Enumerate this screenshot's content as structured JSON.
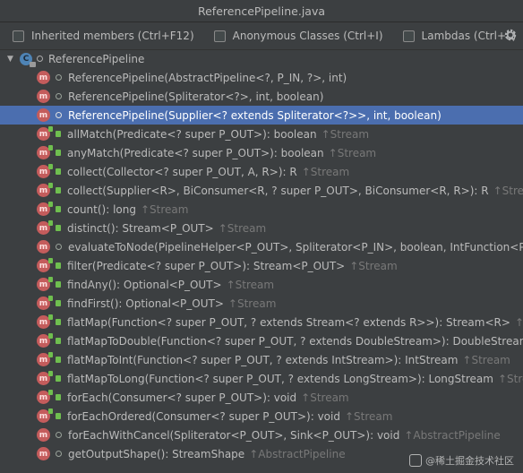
{
  "window": {
    "title": "ReferencePipeline.java"
  },
  "options": [
    {
      "label": "Inherited members (Ctrl+F12)",
      "checked": false
    },
    {
      "label": "Anonymous Classes (Ctrl+I)",
      "checked": false
    },
    {
      "label": "Lambdas (Ctrl+L)",
      "checked": false
    }
  ],
  "settings_icon": "gear-icon",
  "root": {
    "label": "ReferencePipeline",
    "icon": "abstract-class-icon"
  },
  "members": [
    {
      "sig": "ReferencePipeline(AbstractPipeline<?, P_IN, ?>, int)",
      "inherited": "",
      "public": false,
      "selected": false
    },
    {
      "sig": "ReferencePipeline(Spliterator<?>, int, boolean)",
      "inherited": "",
      "public": false,
      "selected": false
    },
    {
      "sig": "ReferencePipeline(Supplier<? extends Spliterator<?>>, int, boolean)",
      "inherited": "",
      "public": false,
      "selected": true
    },
    {
      "sig": "allMatch(Predicate<? super P_OUT>): boolean",
      "inherited": "↑Stream",
      "public": true,
      "selected": false
    },
    {
      "sig": "anyMatch(Predicate<? super P_OUT>): boolean",
      "inherited": "↑Stream",
      "public": true,
      "selected": false
    },
    {
      "sig": "collect(Collector<? super P_OUT, A, R>): R",
      "inherited": "↑Stream",
      "public": true,
      "selected": false
    },
    {
      "sig": "collect(Supplier<R>, BiConsumer<R, ? super P_OUT>, BiConsumer<R, R>): R",
      "inherited": "↑Stream",
      "public": true,
      "selected": false
    },
    {
      "sig": "count(): long",
      "inherited": "↑Stream",
      "public": true,
      "selected": false
    },
    {
      "sig": "distinct(): Stream<P_OUT>",
      "inherited": "↑Stream",
      "public": true,
      "selected": false
    },
    {
      "sig": "evaluateToNode(PipelineHelper<P_OUT>, Spliterator<P_IN>, boolean, IntFunction<P_OUT",
      "inherited": "",
      "public": false,
      "selected": false
    },
    {
      "sig": "filter(Predicate<? super P_OUT>): Stream<P_OUT>",
      "inherited": "↑Stream",
      "public": true,
      "selected": false
    },
    {
      "sig": "findAny(): Optional<P_OUT>",
      "inherited": "↑Stream",
      "public": true,
      "selected": false
    },
    {
      "sig": "findFirst(): Optional<P_OUT>",
      "inherited": "↑Stream",
      "public": true,
      "selected": false
    },
    {
      "sig": "flatMap(Function<? super P_OUT, ? extends Stream<? extends R>>): Stream<R>",
      "inherited": "↑Strea",
      "public": true,
      "selected": false
    },
    {
      "sig": "flatMapToDouble(Function<? super P_OUT, ? extends DoubleStream>): DoubleStream",
      "inherited": "↑",
      "public": true,
      "selected": false
    },
    {
      "sig": "flatMapToInt(Function<? super P_OUT, ? extends IntStream>): IntStream",
      "inherited": "↑Stream",
      "public": true,
      "selected": false
    },
    {
      "sig": "flatMapToLong(Function<? super P_OUT, ? extends LongStream>): LongStream",
      "inherited": "↑Strea",
      "public": true,
      "selected": false
    },
    {
      "sig": "forEach(Consumer<? super P_OUT>): void",
      "inherited": "↑Stream",
      "public": true,
      "selected": false
    },
    {
      "sig": "forEachOrdered(Consumer<? super P_OUT>): void",
      "inherited": "↑Stream",
      "public": true,
      "selected": false
    },
    {
      "sig": "forEachWithCancel(Spliterator<P_OUT>, Sink<P_OUT>): void",
      "inherited": "↑AbstractPipeline",
      "public": false,
      "selected": false
    },
    {
      "sig": "getOutputShape(): StreamShape",
      "inherited": "↑AbstractPipeline",
      "public": false,
      "selected": false
    }
  ],
  "watermark": "@稀土掘金技术社区",
  "colors": {
    "selection": "#4b6eaf",
    "method_icon": "#c45c5c",
    "public_marker": "#6fbf4f",
    "class_icon": "#4e84b6"
  }
}
